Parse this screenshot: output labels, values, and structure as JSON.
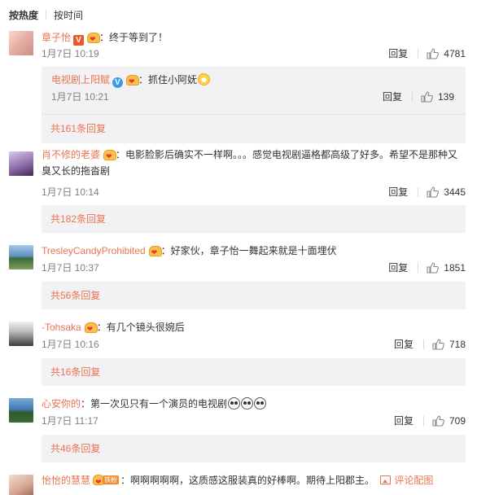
{
  "sort": {
    "active": "按热度",
    "other": "按时间"
  },
  "comments": [
    {
      "user": "章子怡",
      "text": "：终于等到了！",
      "time": "1月7日 10:19",
      "reply_label": "回复",
      "likes": "4781",
      "sub_reply": {
        "user": "电视剧上阳赋",
        "text": "：抓住小阿妩",
        "time": "1月7日 10:21",
        "reply_label": "回复",
        "likes": "139"
      },
      "more": "共161条回复"
    },
    {
      "user": "肖不修的老婆",
      "text": "：电影脸影后确实不一样啊。。。感觉电视剧逼格都高级了好多。希望不是那种又臭又长的拖沓剧",
      "time": "1月7日 10:14",
      "reply_label": "回复",
      "likes": "3445",
      "more": "共182条回复"
    },
    {
      "user": "TresleyCandyProhibited",
      "text": "：好家伙，章子怡一舞起来就是十面埋伏",
      "time": "1月7日 10:37",
      "reply_label": "回复",
      "likes": "1851",
      "more": "共56条回复"
    },
    {
      "user": "-Tohsaka",
      "text": "：有几个镜头很婉后",
      "time": "1月7日 10:16",
      "reply_label": "回复",
      "likes": "718",
      "more": "共16条回复"
    },
    {
      "user": "心安你的",
      "text": "：第一次见只有一个演员的电视剧",
      "time": "1月7日 11:17",
      "reply_label": "回复",
      "likes": "709",
      "more": "共46条回复"
    },
    {
      "user": "怡怡的慧慧",
      "fan_badge": "铁粉",
      "text": "：啊啊啊啊啊，这质感这服装真的好棒啊。期待上阳郡主。",
      "image_link": "评论配图"
    }
  ],
  "colors": {
    "accent": "#eb7350",
    "reply_bg": "#f2f2f5"
  },
  "icons": {
    "like": "thumbs-up-icon",
    "image": "image-icon"
  }
}
